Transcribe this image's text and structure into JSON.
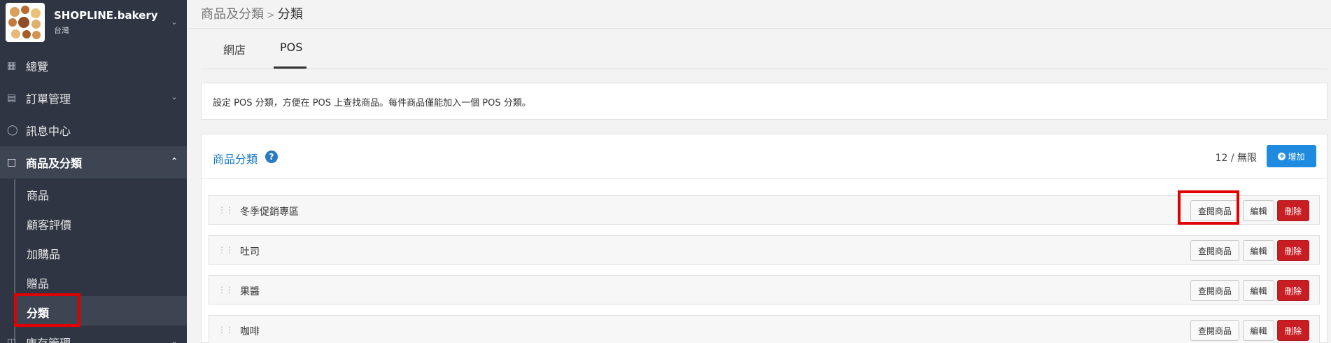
{
  "sidebar": {
    "store_name": "SHOPLINE.bakery",
    "store_region": "台灣",
    "nav": [
      {
        "label": "總覽",
        "icon": "dashboard-icon"
      },
      {
        "label": "訂單管理",
        "icon": "order-icon"
      },
      {
        "label": "訊息中心",
        "icon": "message-icon"
      },
      {
        "label": "商品及分類",
        "icon": "shopping-bag-icon"
      },
      {
        "label": "庫存管理",
        "icon": "inventory-icon"
      }
    ],
    "sub_items": [
      {
        "label": "商品"
      },
      {
        "label": "顧客評價"
      },
      {
        "label": "加購品"
      },
      {
        "label": "贈品"
      },
      {
        "label": "分類"
      }
    ]
  },
  "breadcrumb": {
    "parent": "商品及分類",
    "current": "分類"
  },
  "tabs": [
    {
      "label": "網店"
    },
    {
      "label": "POS"
    }
  ],
  "info_text": "設定 POS 分類，方便在 POS 上查找商品。每件商品僅能加入一個 POS 分類。",
  "panel": {
    "title": "商品分類",
    "help_icon": "?",
    "count": "12 / 無限",
    "add_label": "增加"
  },
  "row_buttons": {
    "view": "查閱商品",
    "edit": "編輯",
    "delete": "刪除"
  },
  "categories": [
    {
      "name": "冬季促銷專區"
    },
    {
      "name": "吐司"
    },
    {
      "name": "果醬"
    },
    {
      "name": "咖啡"
    }
  ],
  "colors": {
    "sidebar_bg": "#2f3542",
    "accent_blue": "#1e8be0",
    "delete_red": "#c91d24",
    "highlight_red": "#e00000"
  }
}
